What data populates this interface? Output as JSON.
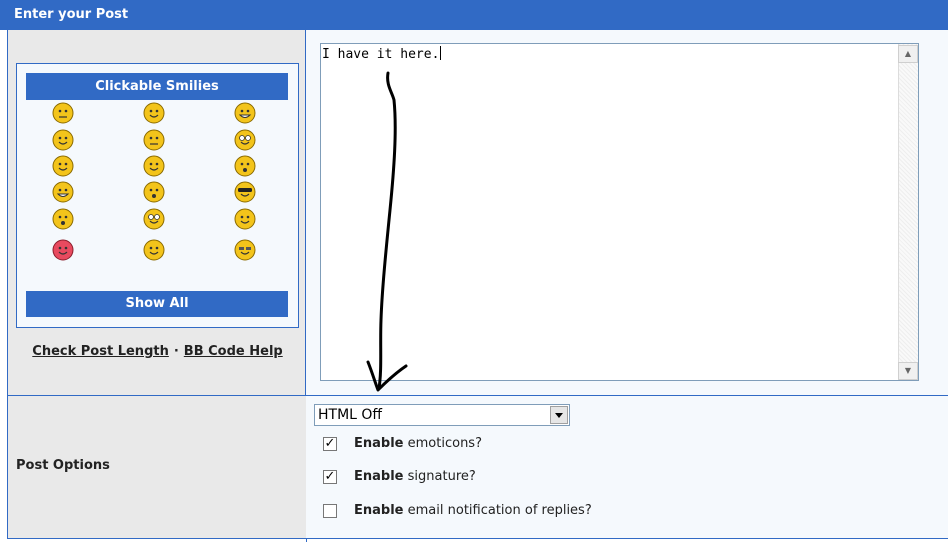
{
  "header": {
    "title": "Enter your Post"
  },
  "smilies": {
    "title": "Clickable Smilies",
    "show_all_label": "Show All",
    "icons": [
      "neutral-smiley-icon",
      "smile-smiley-icon",
      "grin-smiley-icon",
      "tongue-smiley-icon",
      "angry-smiley-icon",
      "wide-eyed-smiley-icon",
      "blushing-smiley-icon",
      "flower-smiley-icon",
      "whistle-smiley-icon",
      "big-grin-smiley-icon",
      "surprised-smiley-icon",
      "sunglasses-smiley-icon",
      "shocked-smiley-icon",
      "rolling-eyes-smiley-icon",
      "confused-smiley-icon",
      "in-love-smiley-icon",
      "wink-smiley-icon",
      "cool-smiley-icon"
    ]
  },
  "links": {
    "check_length": "Check Post Length",
    "separator": "·",
    "bb_code_help": "BB Code Help"
  },
  "editor": {
    "text": "I have it here."
  },
  "post_options": {
    "label": "Post Options",
    "html_select_value": "HTML Off",
    "options": [
      {
        "bold": "Enable",
        "rest": "emoticons?",
        "checked": true
      },
      {
        "bold": "Enable",
        "rest": "signature?",
        "checked": true
      },
      {
        "bold": "Enable",
        "rest": "email notification of replies?",
        "checked": false
      }
    ]
  },
  "colors": {
    "header_blue": "#316ac5",
    "panel_gray": "#e9e9e9",
    "panel_light": "#f5f9fd"
  },
  "annotation": {
    "description": "hand-drawn-arrow"
  }
}
